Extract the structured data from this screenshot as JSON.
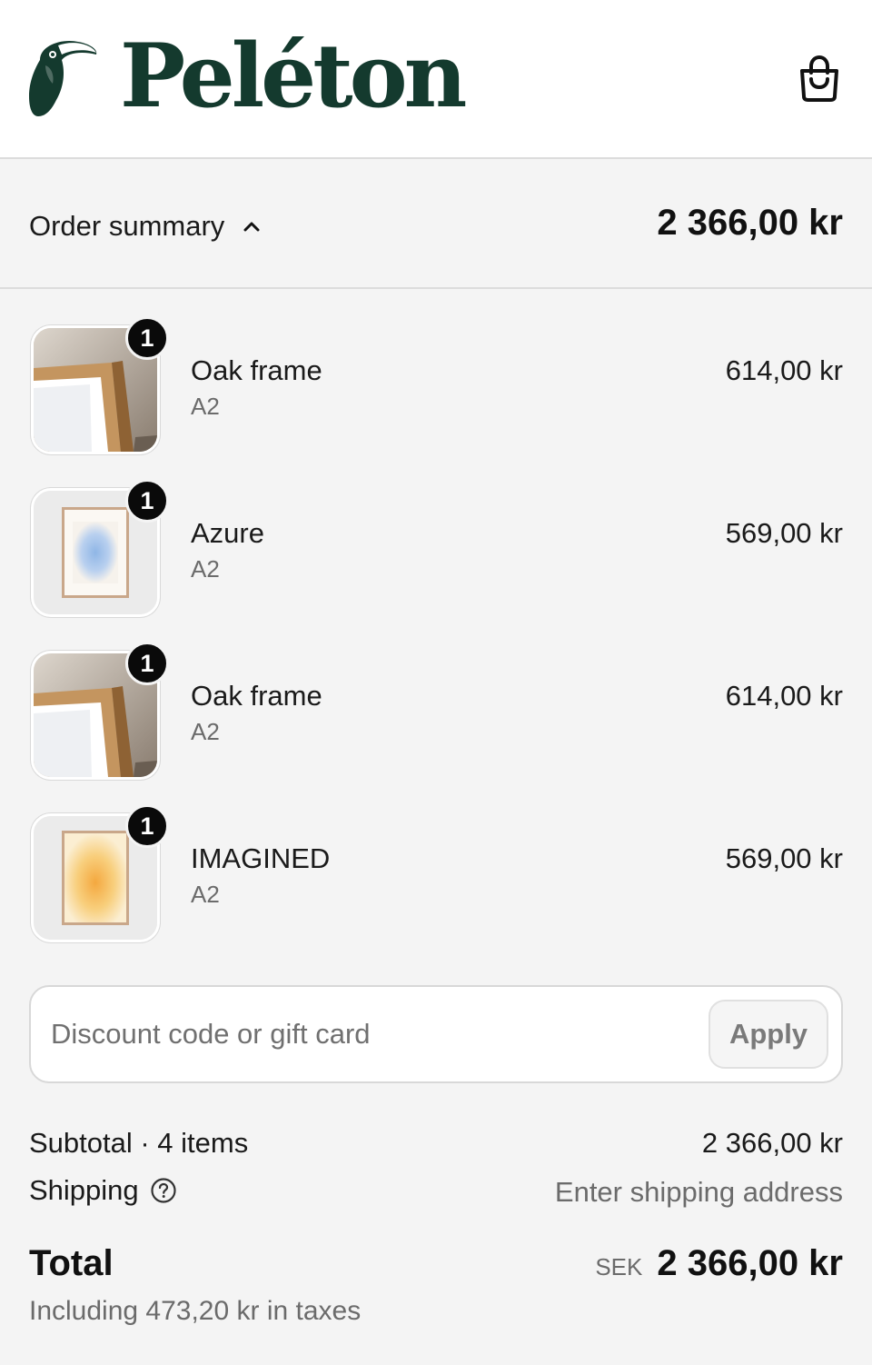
{
  "header": {
    "brand": "Peléton",
    "logo_icon": "toucan-logo-icon",
    "cart_icon": "shopping-bag-icon",
    "brand_color": "#143a2e"
  },
  "summary": {
    "label": "Order summary",
    "toggle_icon": "chevron-up-icon",
    "total": "2 366,00 kr"
  },
  "items": [
    {
      "name": "Oak frame",
      "variant": "A2",
      "price": "614,00 kr",
      "quantity": "1",
      "image": "oak-frame"
    },
    {
      "name": "Azure",
      "variant": "A2",
      "price": "569,00 kr",
      "quantity": "1",
      "image": "azure-print"
    },
    {
      "name": "Oak frame",
      "variant": "A2",
      "price": "614,00 kr",
      "quantity": "1",
      "image": "oak-frame"
    },
    {
      "name": "IMAGINED",
      "variant": "A2",
      "price": "569,00 kr",
      "quantity": "1",
      "image": "imagined-print"
    }
  ],
  "discount": {
    "placeholder": "Discount code or gift card",
    "value": "",
    "apply_label": "Apply"
  },
  "totals": {
    "subtotal_label": "Subtotal · 4 items",
    "subtotal_value": "2 366,00 kr",
    "shipping_label": "Shipping",
    "shipping_icon": "help-circle-icon",
    "shipping_value": "Enter shipping address",
    "total_label": "Total",
    "currency": "SEK",
    "total_value": "2 366,00 kr",
    "taxes_note": "Including 473,20 kr in taxes"
  }
}
